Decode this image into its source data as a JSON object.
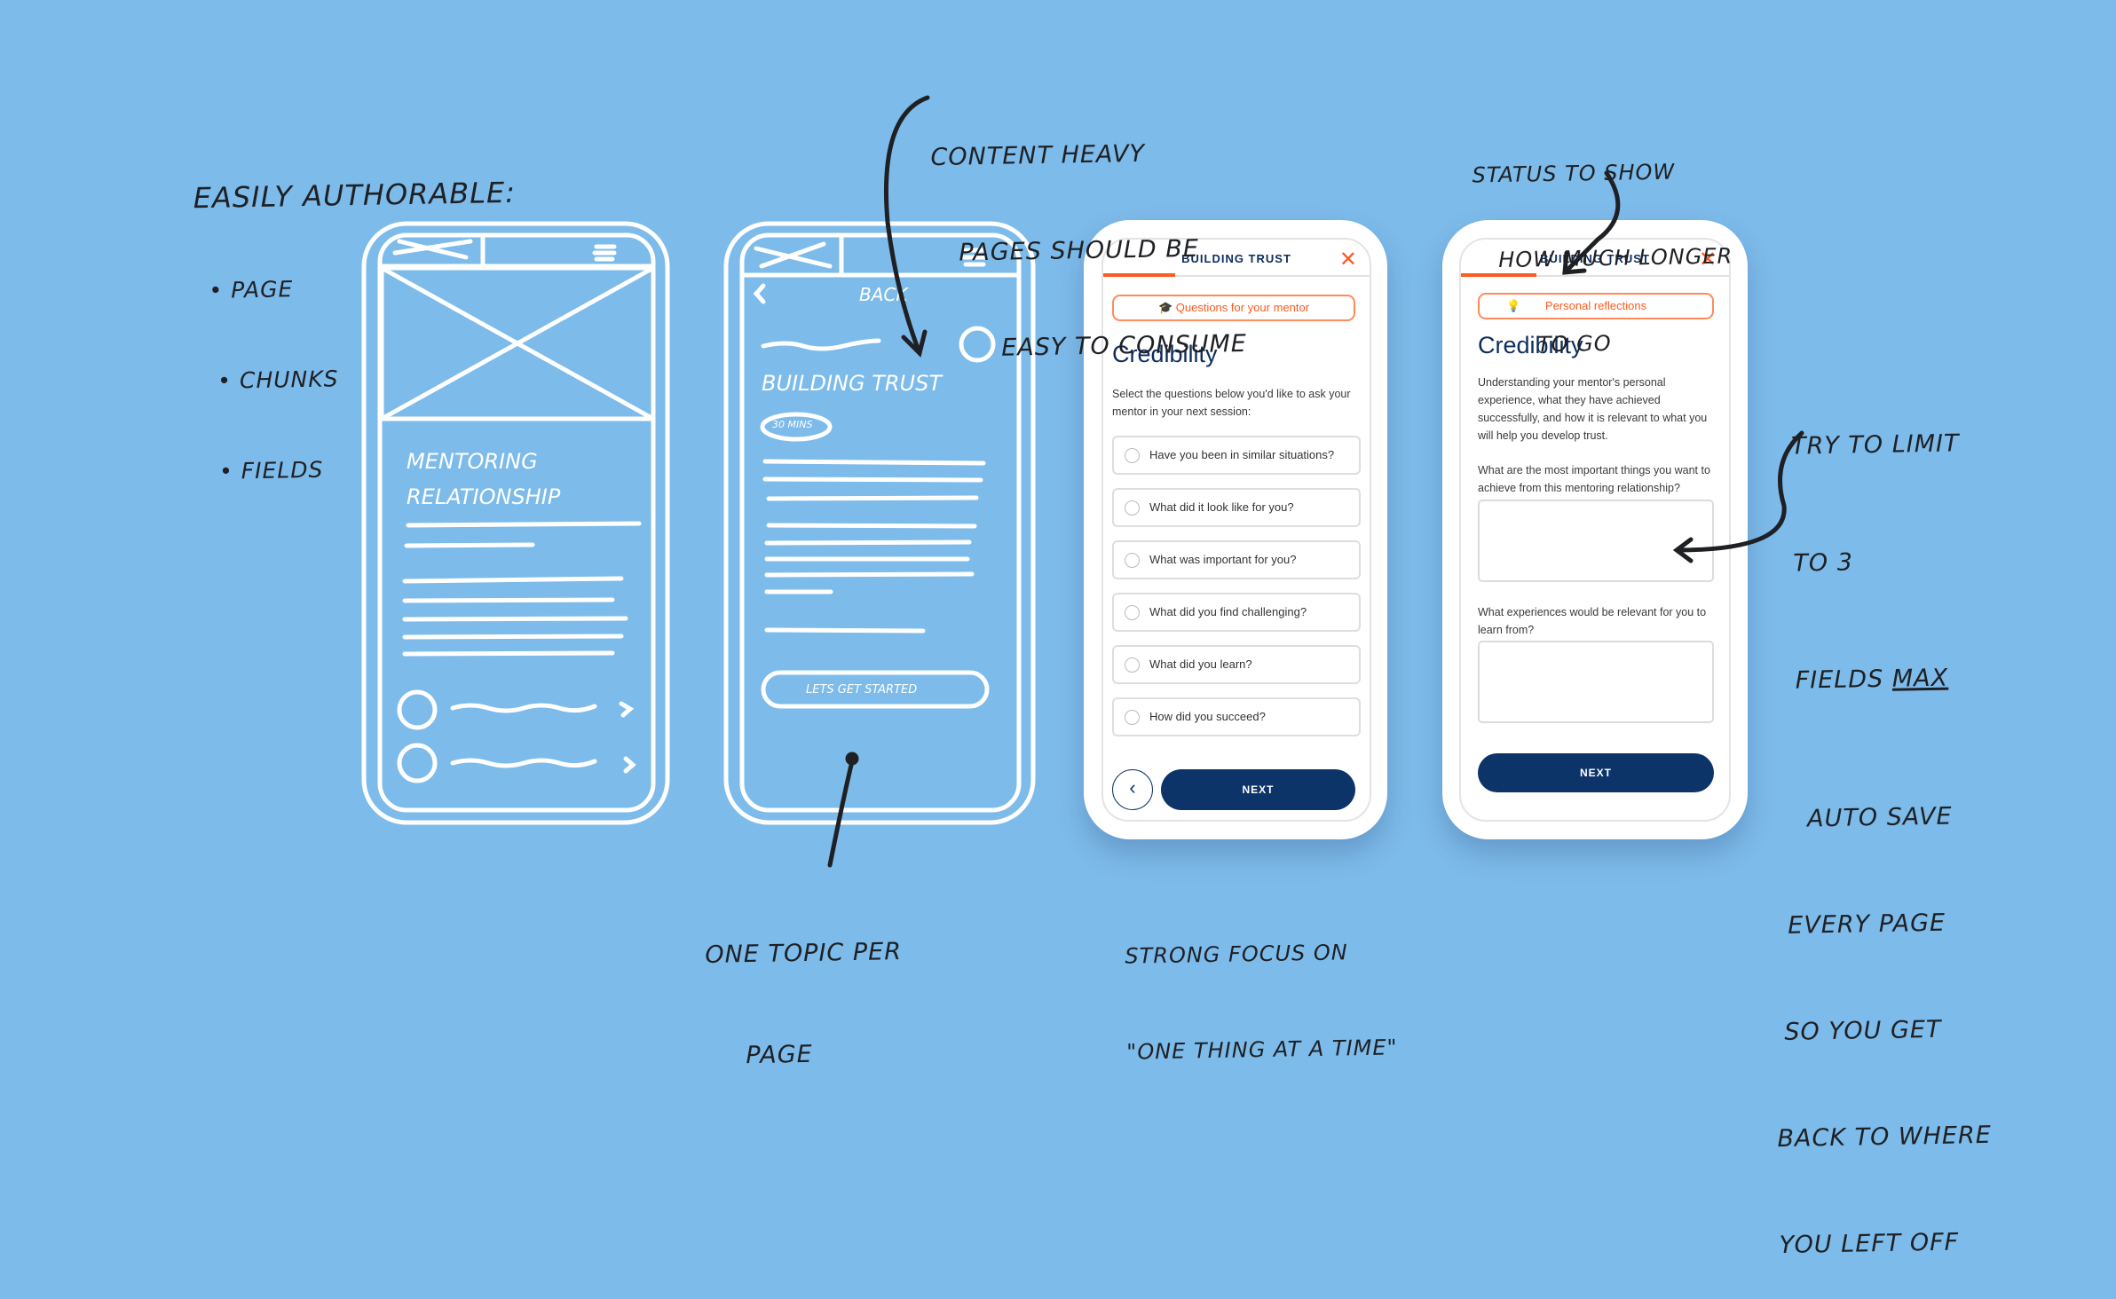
{
  "colors": {
    "background": "#7dbbea",
    "accent": "#ff5a1f",
    "primary": "#0d3468",
    "heading": "#0d2d5e"
  },
  "annotations": {
    "authorable": {
      "title": "Easily authorable:",
      "items": [
        "• Page",
        "• Chunks",
        "• Fields"
      ]
    },
    "content_heavy": [
      "Content heavy",
      "pages should be",
      "easy to consume"
    ],
    "status": [
      "Status to show",
      "how much longer",
      "to go"
    ],
    "limit": [
      "Try to limit",
      "to 3",
      "Fields"
    ],
    "limit_emph": "max",
    "autosave": [
      "Auto save",
      "every page",
      "so you get",
      "back to where",
      "you left off"
    ],
    "one_topic": [
      "One topic per",
      "page"
    ],
    "focus": [
      "Strong focus on",
      "\"One thing at a time\""
    ]
  },
  "sketch1": {
    "title": [
      "Mentoring",
      "relationship"
    ]
  },
  "sketch2": {
    "back": "Back",
    "title": "Building trust",
    "duration": "30 mins",
    "cta": "Lets get started"
  },
  "screen1": {
    "header": "BUILDING TRUST",
    "close_icon": "close-icon",
    "progress_percent": 27,
    "tag": {
      "icon": "graduation-cap-icon",
      "label": "Questions for your mentor"
    },
    "heading": "Credibility",
    "description": "Select the questions below you'd like to ask your mentor in your next session:",
    "options": [
      "Have you been in similar situations?",
      "What did it look like for you?",
      "What was important for you?",
      "What did you find challenging?",
      "What did you learn?",
      "How did you succeed?"
    ],
    "back_icon": "chevron-left-icon",
    "next": "NEXT"
  },
  "screen2": {
    "header": "BUILDING TRUST",
    "progress_percent": 27,
    "tag": {
      "icon": "lightbulb-icon",
      "label": "Personal reflections"
    },
    "heading": "Credibility",
    "description": "Understanding your mentor's personal experience, what they have achieved successfully, and how it is relevant to what you will help you develop trust.",
    "q1": "What are the most important things you want to achieve from this mentoring relationship?",
    "q2": "What experiences would be relevant for you to learn from?",
    "next": "NEXT"
  }
}
